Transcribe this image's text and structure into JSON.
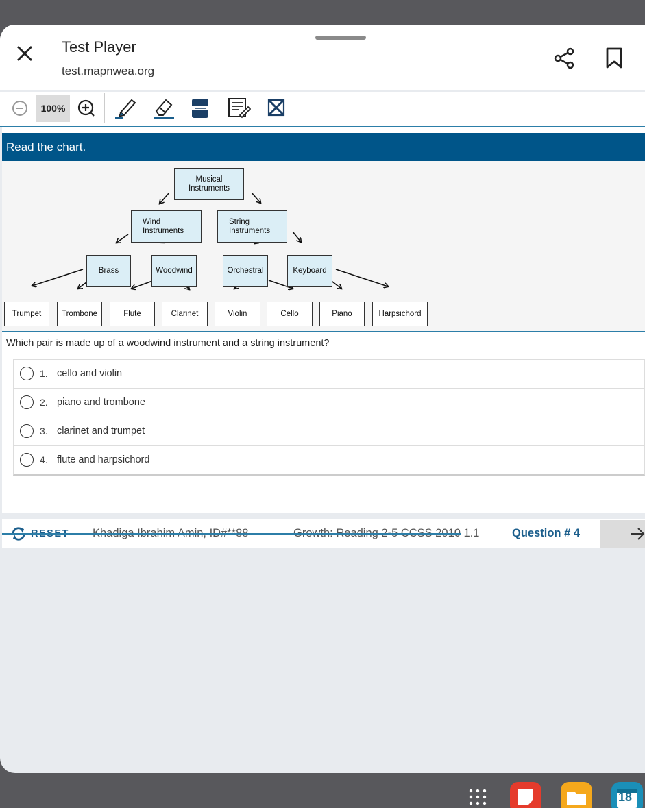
{
  "header": {
    "title": "Test Player",
    "url": "test.mapnwea.org"
  },
  "toolbar": {
    "zoom": "100%"
  },
  "question": {
    "instruction": "Read the chart.",
    "chart": {
      "nodes": {
        "root": "Musical Instruments",
        "wind": "Wind Instruments",
        "string": "String Instruments",
        "brass": "Brass",
        "woodwind": "Woodwind",
        "orchestral": "Orchestral",
        "keyboard": "Keyboard",
        "trumpet": "Trumpet",
        "trombone": "Trombone",
        "flute": "Flute",
        "clarinet": "Clarinet",
        "violin": "Violin",
        "cello": "Cello",
        "piano": "Piano",
        "harpsichord": "Harpsichord"
      }
    },
    "prompt": "Which pair is made up of a woodwind instrument and a string instrument?",
    "options": [
      {
        "num": "1.",
        "text": "cello and violin"
      },
      {
        "num": "2.",
        "text": "piano and trombone"
      },
      {
        "num": "3.",
        "text": "clarinet and trumpet"
      },
      {
        "num": "4.",
        "text": "flute and harpsichord"
      }
    ]
  },
  "footer": {
    "reset_label": "RESET",
    "student": "Khadiga Ibrahim Amin, ID#**88",
    "test_name": "Growth: Reading 2-5 CCSS 2010 1.1",
    "question_number": "Question # 4"
  },
  "dock": {
    "calendar_day": "18"
  },
  "colors": {
    "banner": "#005589",
    "accent": "#2c7ea8",
    "node_fill": "#dbeef6"
  }
}
